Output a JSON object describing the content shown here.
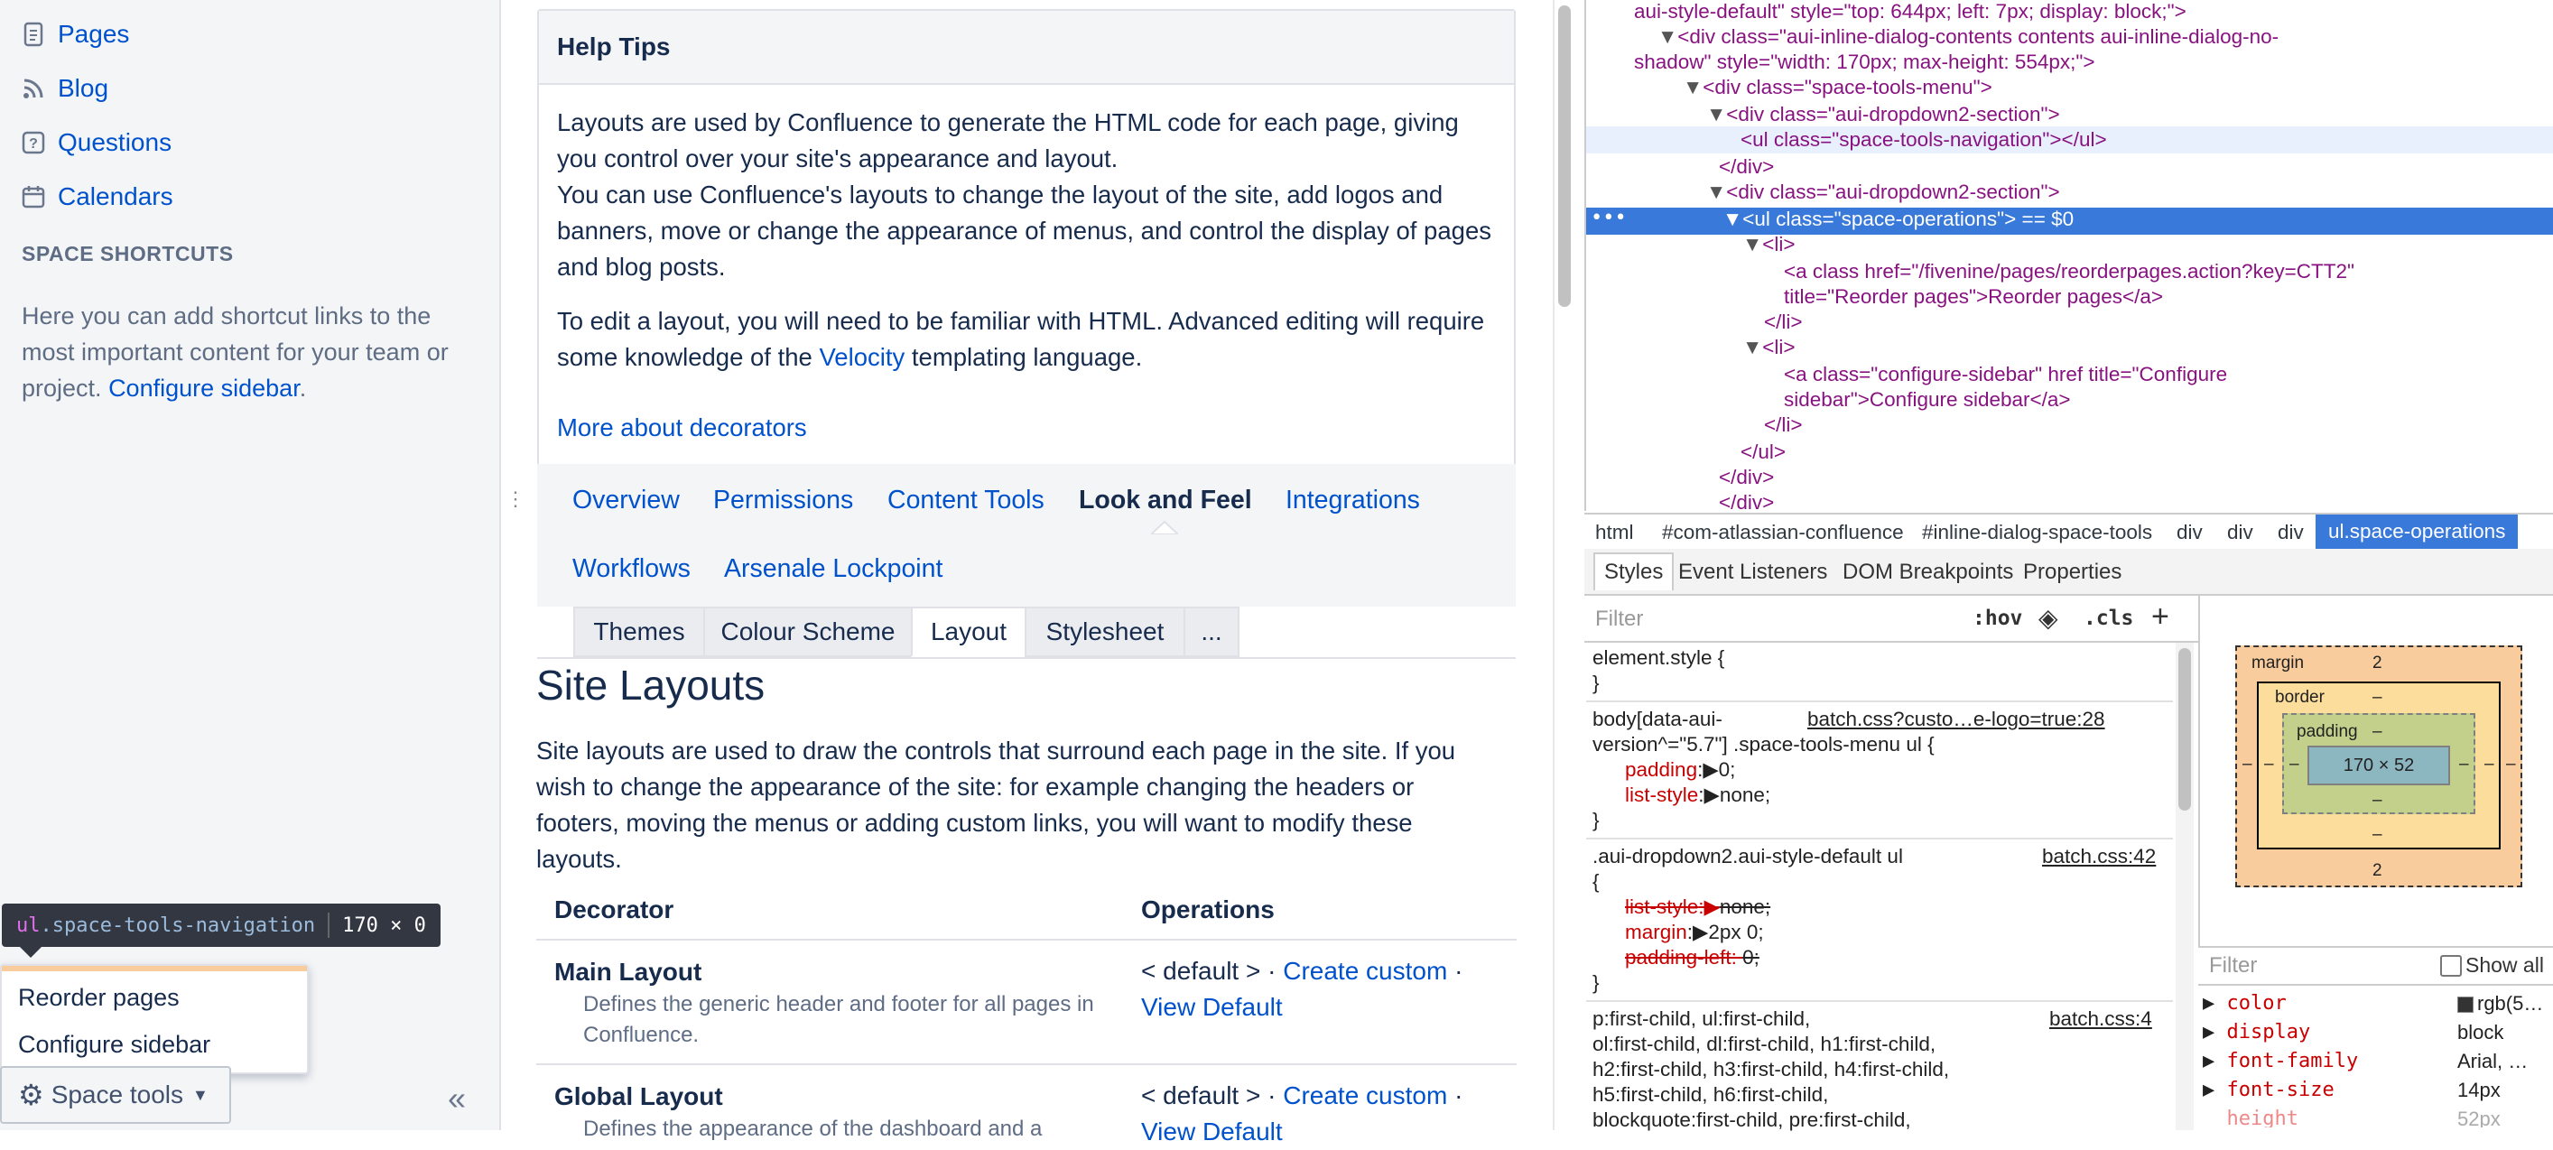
{
  "sidebar": {
    "items": [
      {
        "label": "Pages",
        "icon": "page-icon"
      },
      {
        "label": "Blog",
        "icon": "rss-icon"
      },
      {
        "label": "Questions",
        "icon": "question-icon"
      },
      {
        "label": "Calendars",
        "icon": "calendar-icon"
      }
    ],
    "shortcuts_heading": "SPACE SHORTCUTS",
    "shortcuts_text": "Here you can add shortcut links to the most important content for your team or project.",
    "configure_link": "Configure sidebar",
    "period": "."
  },
  "inspect_tooltip": {
    "tag": "ul",
    "cls": ".space-tools-navigation",
    "size": "170 × 0"
  },
  "dropdown": {
    "items": [
      "Reorder pages",
      "Configure sidebar"
    ]
  },
  "space_tools": {
    "label": "Space tools",
    "collapse": "«"
  },
  "help": {
    "title": "Help Tips",
    "p1": "Layouts are used by Confluence to generate the HTML code for each page, giving you control over your site's appearance and layout.",
    "p2": "You can use Confluence's layouts to change the layout of the site, add logos and banners, move or change the appearance of menus, and control the display of pages and blog posts.",
    "p3_pre": "To edit a layout, you will need to be familiar with HTML. Advanced editing will require some knowledge of the ",
    "p3_link": "Velocity",
    "p3_post": " templating language.",
    "more": "More about decorators"
  },
  "tabs": [
    "Overview",
    "Permissions",
    "Content Tools",
    "Look and Feel",
    "Integrations",
    "Workflows",
    "Arsenale Lockpoint"
  ],
  "subtabs": [
    "Themes",
    "Colour Scheme",
    "Layout",
    "Stylesheet",
    "..."
  ],
  "site_layouts": {
    "title": "Site Layouts",
    "desc": "Site layouts are used to draw the controls that surround each page in the site. If you wish to change the appearance of the site: for example changing the headers or footers, moving the menus or adding custom links, you will want to modify these layouts.",
    "col_decorator": "Decorator",
    "col_operations": "Operations",
    "rows": [
      {
        "name": "Main Layout",
        "desc": "Defines the generic header and footer for all pages in Confluence.",
        "default": "< default > · ",
        "create": "Create custom",
        "sep": " ·",
        "view": "View Default"
      },
      {
        "name": "Global Layout",
        "desc": "Defines the appearance of the dashboard and a",
        "default": "< default > · ",
        "create": "Create custom",
        "sep": " ·",
        "view": "View Default"
      }
    ]
  },
  "devtools": {
    "dom_lines": [
      "aui-style-default\" style=\"top: 644px; left: 7px; display: block;\">",
      "<div class=\"aui-inline-dialog-contents contents aui-inline-dialog-no-",
      "shadow\" style=\"width: 170px; max-height: 554px;\">",
      "<div class=\"space-tools-menu\">",
      "<div class=\"aui-dropdown2-section\">",
      "<ul class=\"space-tools-navigation\"></ul>",
      "</div>",
      "<div class=\"aui-dropdown2-section\">",
      "<ul class=\"space-operations\"> == $0",
      "<li>",
      "<a class href=\"/fivenine/pages/reorderpages.action?key=CTT2\"",
      "title=\"Reorder pages\">Reorder pages</a>",
      "</li>",
      "<li>",
      "<a class=\"configure-sidebar\" href title=\"Configure",
      "sidebar\">Configure sidebar</a>",
      "</li>",
      "</ul>",
      "</div>",
      "</div>"
    ],
    "breadcrumbs": [
      "html",
      "#com-atlassian-confluence",
      "#inline-dialog-space-tools",
      "div",
      "div",
      "div",
      "ul.space-operations"
    ],
    "style_tabs": [
      "Styles",
      "Event Listeners",
      "DOM Breakpoints",
      "Properties"
    ],
    "filter_placeholder": "Filter",
    "hov": ":hov",
    "cls": ".cls",
    "styles": {
      "element_style": "element.style {",
      "close": "}",
      "r1_sel_a": "body[data-aui-",
      "r1_src": "batch.css?custo…e-logo=true:28",
      "r1_sel_b": "version^=\"5.7\"] .space-tools-menu ul {",
      "r1_p1": "padding",
      "r1_v1": "0;",
      "r1_p2": "list-style",
      "r1_v2": "none;",
      "r2_sel": ".aui-dropdown2.aui-style-default ul",
      "r2_src": "batch.css:42",
      "r2_open": "{",
      "r2_p1": "list-style",
      "r2_v1": "none;",
      "r2_p2": "margin",
      "r2_v2": "2px 0;",
      "r2_p3": "padding-left",
      "r2_v3": "0;",
      "r3_sel": "p:first-child, ul:first-child,",
      "r3_src": "batch.css:4",
      "r3_l2": "ol:first-child, dl:first-child, h1:first-child,",
      "r3_l3": "h2:first-child, h3:first-child, h4:first-child,",
      "r3_l4": "h5:first-child, h6:first-child,",
      "r3_l5": "blockquote:first-child, pre:first-child,"
    },
    "box_model": {
      "margin_label": "margin",
      "margin_top": "2",
      "margin_bottom": "2",
      "margin_left": "–",
      "margin_right": "–",
      "border_label": "border",
      "border_val": "–",
      "border_bottom": "–",
      "border_left": "–",
      "border_right": "–",
      "padding_label": "padding",
      "padding_val": "–",
      "padding_bottom": "–",
      "padding_left": "–",
      "padding_right": "–",
      "content": "170 × 52"
    },
    "computed_filter": "Filter",
    "show_all": "Show all",
    "computed": [
      {
        "prop": "color",
        "value": "rgb(5…"
      },
      {
        "prop": "display",
        "value": "block"
      },
      {
        "prop": "font-family",
        "value": "Arial, …"
      },
      {
        "prop": "font-size",
        "value": "14px"
      },
      {
        "prop": "height",
        "value": "52px"
      }
    ]
  }
}
